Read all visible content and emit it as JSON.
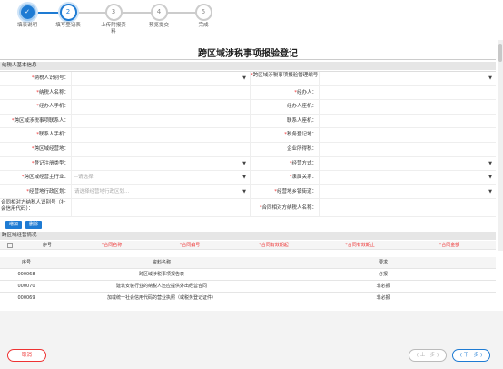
{
  "steps": [
    {
      "num": "✓",
      "label": "填表说明",
      "state": "done"
    },
    {
      "num": "2",
      "label": "填写登记表",
      "state": "active"
    },
    {
      "num": "3",
      "label": "上传附报资料",
      "state": "todo"
    },
    {
      "num": "4",
      "label": "预览提交",
      "state": "todo"
    },
    {
      "num": "5",
      "label": "完成",
      "state": "todo"
    }
  ],
  "title": "跨区域涉税事项报验登记",
  "basic_section": "纳税人基本信息",
  "form": {
    "r1": {
      "l1": "纳税人识别号：",
      "l2": "跨区域涉税事项报验管理编号："
    },
    "r2": {
      "l1": "纳税人名称：",
      "l2": "经办人："
    },
    "r3": {
      "l1": "经办人手机：",
      "l2": "经办人座机："
    },
    "r4": {
      "l1": "跨区域涉税事项联系人：",
      "l2": "联系人座机："
    },
    "r5": {
      "l1": "联系人手机：",
      "l2": "税务登记地："
    },
    "r6": {
      "l1": "跨区域经营地：",
      "l2": "企业所得税："
    },
    "r7": {
      "l1": "登记注册类型：",
      "l2": "经营方式："
    },
    "r8": {
      "l1": "跨区域经营主行业：",
      "v1": "--请选择",
      "l2": "隶属关系："
    },
    "r9": {
      "l1": "经营地行政区划：",
      "v1": "请选择经营地行政区划...",
      "l2": "经营地乡镇街道："
    },
    "r10": {
      "l1": "合同相对方纳税人识别号（社会信用代码）：",
      "l2": "合同相对方纳税人名称："
    }
  },
  "buttons": {
    "add": "增加",
    "delete": "删除"
  },
  "ops_section": "跨区域经营情况",
  "ops_headers": [
    "序号",
    "合同名称",
    "合同编号",
    "合同有效期起",
    "合同有效期止",
    "合同金额"
  ],
  "attachments": {
    "headers": [
      "序号",
      "资料名称",
      "要求"
    ],
    "rows": [
      {
        "id": "000068",
        "name": "跨区域涉税事项报告表",
        "req": "必报"
      },
      {
        "id": "000070",
        "name": "建筑安装行业的纳税人还应提供外出经营合同",
        "req": "非必报"
      },
      {
        "id": "000069",
        "name": "加载统一社会信用代码的营业执照（或税务登记证件）",
        "req": "非必报"
      }
    ]
  },
  "footer": {
    "cancel": "取消",
    "prev": "上一步",
    "next": "下一步"
  },
  "colors": {
    "accent": "#1e7bd3",
    "danger": "#e33333"
  }
}
